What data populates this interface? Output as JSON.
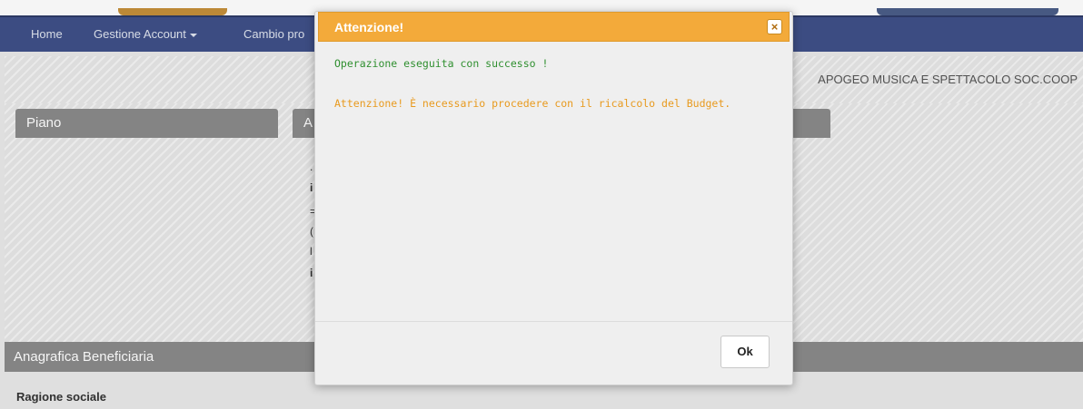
{
  "navbar": {
    "items": [
      {
        "label": "Home"
      },
      {
        "label": "Gestione Account"
      },
      {
        "label": "Cambio pro"
      }
    ]
  },
  "subbar": {
    "beneficiary_text": "APOGEO MUSICA E SPETTACOLO SOC.COOP"
  },
  "panels": {
    "piano_title": "Piano",
    "second_title_fragment": "A"
  },
  "sections": {
    "anagrafica_title": "Anagrafica Beneficiaria",
    "ragione_sociale_label": "Ragione sociale"
  },
  "modal": {
    "title": "Attenzione!",
    "close_glyph": "×",
    "success_message": "Operazione eseguita con successo !",
    "warning_message": "Attenzione! È necessario procedere con il ricalcolo del Budget.",
    "ok_label": "Ok",
    "colors": {
      "header": "#f3aa3a",
      "success_text": "#2f8f2f",
      "warning_text": "#e89a1e"
    }
  }
}
